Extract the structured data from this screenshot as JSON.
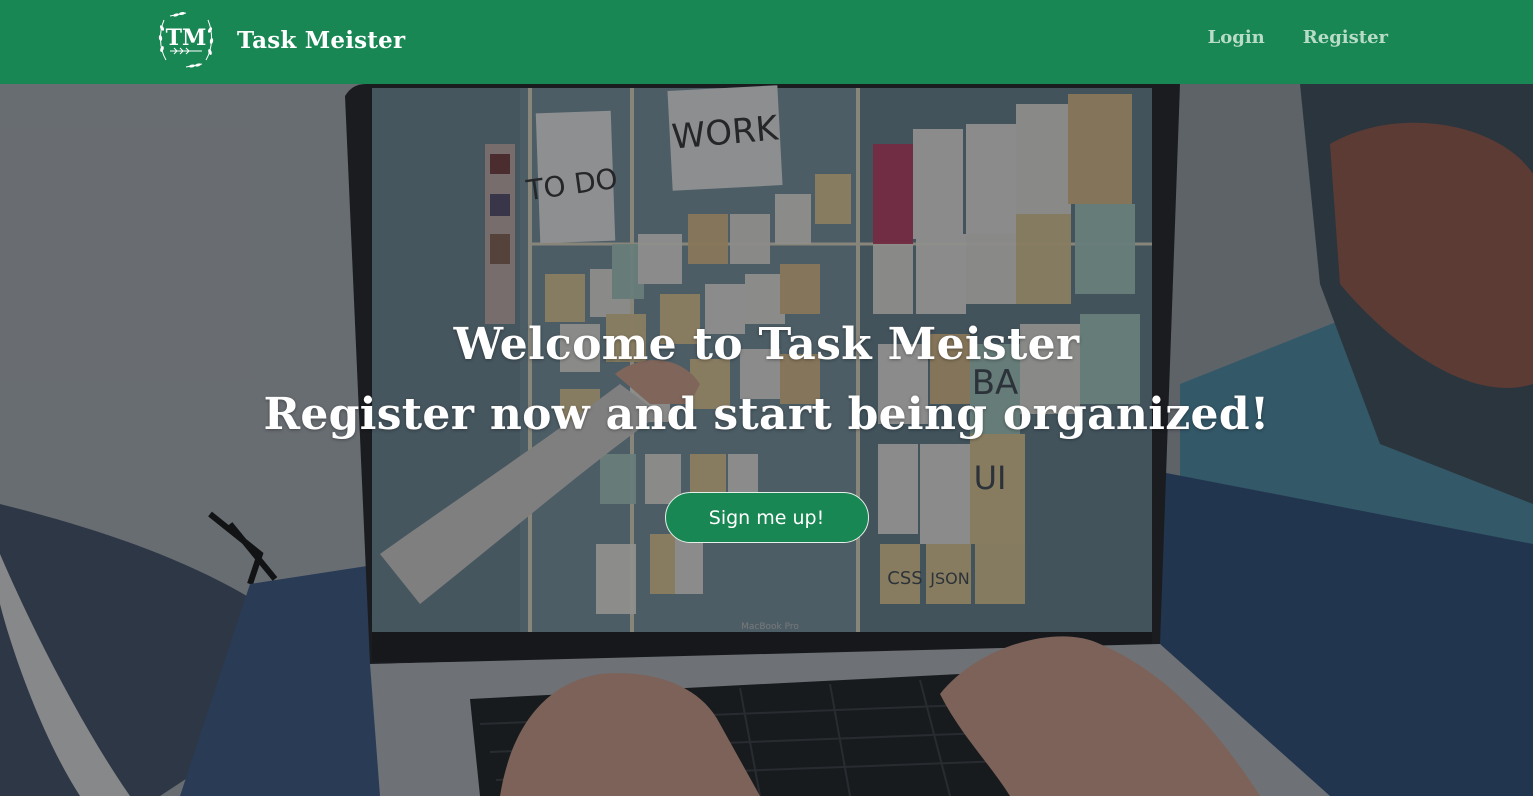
{
  "nav": {
    "logo_text": "TM",
    "brand": "Task Meister",
    "login": "Login",
    "register": "Register"
  },
  "hero": {
    "line1": "Welcome to Task Meister",
    "line2": "Register now and start being organized!",
    "cta": "Sign me up!",
    "board": {
      "todo": "TO DO",
      "work": "WORK",
      "notes": [
        "BA",
        "UI",
        "CSS",
        "JSON"
      ]
    },
    "laptop_brand": "MacBook Pro"
  },
  "colors": {
    "primary": "#198754",
    "nav_link": "#b9dcc8",
    "overlay": "rgba(20,22,26,0.45)"
  }
}
